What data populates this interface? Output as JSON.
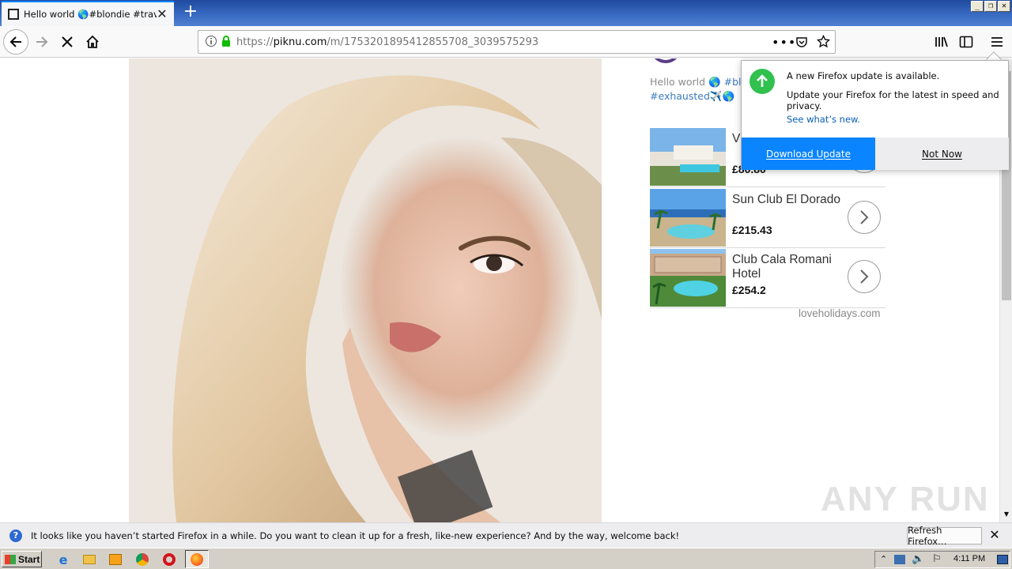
{
  "browser": {
    "tab": {
      "title": "Hello world 🌎#blondie #travel #r"
    },
    "url": {
      "scheme_host_prefix": "https://",
      "host": "piknu.com",
      "path": "/m/1753201895412855708_3039575293"
    }
  },
  "post": {
    "caption_line1_text": "Hello world 🌎 ",
    "caption_line1_tag": "#blon",
    "caption_line2_tag": "#exhausted",
    "caption_line2_emoji": "✈️🌎"
  },
  "ads": {
    "items": [
      {
        "name": "V",
        "price": "£80.80"
      },
      {
        "name": "Sun Club El Dorado",
        "price": "£215.43"
      },
      {
        "name": "Club Cala Romani Hotel",
        "price": "£254.2"
      }
    ],
    "footer": "loveholidays.com"
  },
  "update_popup": {
    "title": "A new Firefox update is available.",
    "body": "Update your Firefox for the latest in speed and privacy.",
    "link": "See what’s new.",
    "download_label": "Download Update",
    "notnow_label": "Not Now"
  },
  "notification": {
    "message": "It looks like you haven’t started Firefox in a while. Do you want to clean it up for a fresh, like-new experience? And by the way, welcome back!",
    "refresh_label": "Refresh Firefox…"
  },
  "taskbar": {
    "start_label": "Start",
    "clock": "4:11 PM"
  },
  "watermark": "ANY RUN",
  "colors": {
    "accent": "#0a84ff",
    "update_green": "#30c14e",
    "tag_blue": "#3b7bbf"
  }
}
